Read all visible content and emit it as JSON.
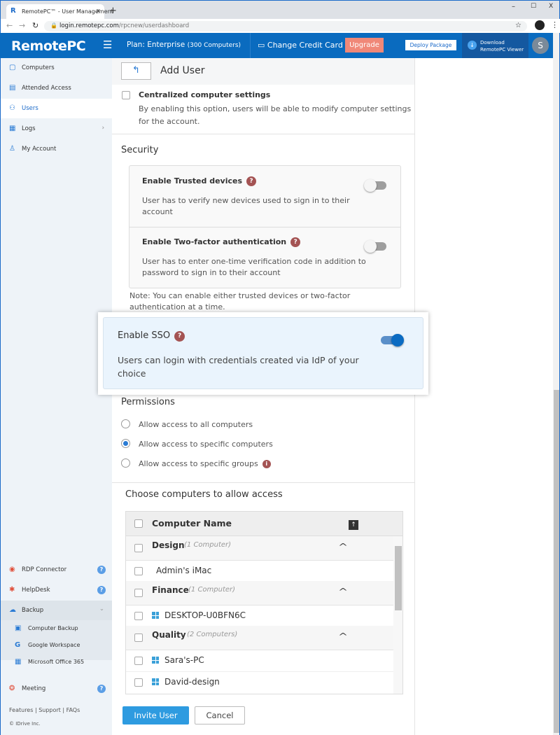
{
  "browser": {
    "tab_title": "RemotePC™ - User Management",
    "url_host": "login.remotepc.com",
    "url_path": "/rpcnew/userdashboard"
  },
  "header": {
    "logo": "RemotePC",
    "plan_label": "Plan: Enterprise",
    "plan_detail": "(300 Computers)",
    "change_card": "Change Credit Card",
    "upgrade": "Upgrade",
    "deploy": "Deploy Package",
    "download_line1": "Download",
    "download_line2": "RemotePC Viewer",
    "avatar": "S"
  },
  "sidebar": {
    "items": [
      {
        "label": "Computers"
      },
      {
        "label": "Attended Access"
      },
      {
        "label": "Users"
      },
      {
        "label": "Logs"
      },
      {
        "label": "My Account"
      }
    ],
    "bottom": [
      {
        "label": "RDP Connector"
      },
      {
        "label": "HelpDesk"
      },
      {
        "label": "Backup"
      },
      {
        "label": "Computer Backup"
      },
      {
        "label": "Google Workspace"
      },
      {
        "label": "Microsoft Office 365"
      },
      {
        "label": "Meeting"
      }
    ],
    "footer_links": [
      "Features",
      "Support",
      "FAQs"
    ],
    "copyright": "© IDrive Inc."
  },
  "page": {
    "title": "Add User",
    "centralized": {
      "title": "Centralized computer settings",
      "desc": "By enabling this option, users will be able to modify computer settings for the account.",
      "checked": false
    },
    "security": {
      "heading": "Security",
      "trusted": {
        "title": "Enable Trusted devices",
        "desc": "User has to verify new devices used to sign in to their account",
        "enabled": false
      },
      "twofa": {
        "title": "Enable Two-factor authentication",
        "desc": "User has to enter one-time verification code in addition to password to sign in to their account",
        "enabled": false
      },
      "note": "Note: You can enable either trusted devices or two-factor authentication at a time."
    },
    "sso": {
      "title": "Enable SSO",
      "desc": "Users can login with credentials created via IdP of your choice",
      "enabled": true
    },
    "permissions": {
      "heading": "Permissions",
      "options": [
        "Allow access to all computers",
        "Allow access to specific computers",
        "Allow access to specific groups"
      ],
      "selected": 1
    },
    "computers": {
      "heading": "Choose computers to allow access",
      "column": "Computer Name",
      "groups": [
        {
          "name": "Design",
          "count": "(1 Computer)",
          "items": [
            {
              "name": "Admin's iMac",
              "os": "apple"
            }
          ]
        },
        {
          "name": "Finance",
          "count": "(1 Computer)",
          "items": [
            {
              "name": "DESKTOP-U0BFN6C",
              "os": "windows"
            }
          ]
        },
        {
          "name": "Quality",
          "count": "(2 Computers)",
          "items": [
            {
              "name": "Sara's-PC",
              "os": "windows"
            },
            {
              "name": "David-design",
              "os": "windows"
            }
          ]
        }
      ]
    },
    "invite": "Invite User",
    "cancel": "Cancel"
  },
  "colors": {
    "brand": "#0a6bbf",
    "upgrade": "#f08878",
    "help": "#a45353"
  }
}
